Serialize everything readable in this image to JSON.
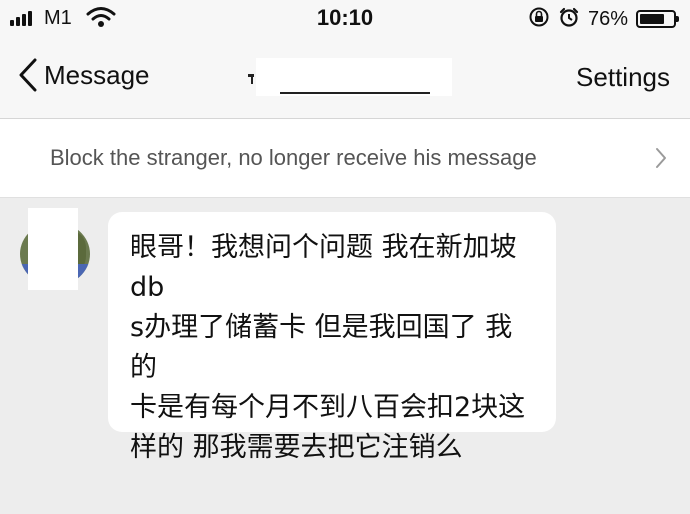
{
  "status_bar": {
    "carrier": "M1",
    "time": "10:10",
    "battery_percent": "76%",
    "battery_level": 0.76
  },
  "nav": {
    "back_label": "Message",
    "settings_label": "Settings"
  },
  "block_bar": {
    "text": "Block the stranger, no longer receive his message"
  },
  "message": {
    "sender": "stranger",
    "text": "眼哥！我想问个问题 我在新加坡dbs办理了储蓄卡 但是我回国了 我的卡是有每个月不到八百会扣2块这样的 那我需要去把它注销么"
  },
  "colors": {
    "background": "#ededed",
    "bar": "#f7f7f7",
    "bubble": "#ffffff"
  }
}
